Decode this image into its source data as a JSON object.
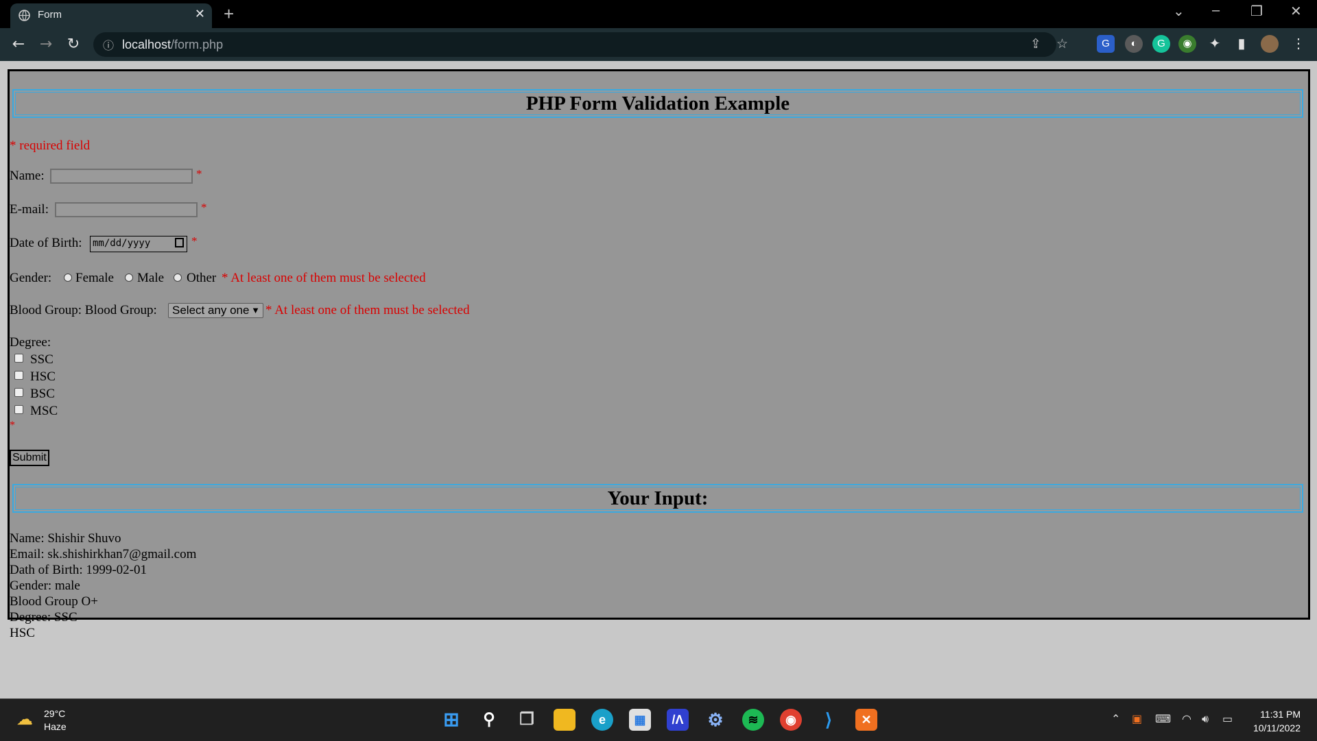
{
  "browser": {
    "tab_title": "Form",
    "tab_close": "✕",
    "new_tab": "+",
    "url_host": "localhost",
    "url_path": "/form.php",
    "controls": {
      "dropdown": "⌄",
      "minimize": "–",
      "restore": "❐",
      "close": "✕"
    }
  },
  "form": {
    "heading": "PHP Form Validation Example",
    "required_note": "* required field",
    "name_label": "Name:",
    "email_label": "E-mail:",
    "dob_label": "Date of Birth:",
    "dob_placeholder": "mm/dd/yyyy",
    "star": "*",
    "gender_label": "Gender:",
    "gender_options": [
      "Female",
      "Male",
      "Other"
    ],
    "gender_error": "* At least one of them must be selected",
    "blood_label": "Blood Group: Blood Group:",
    "blood_select_value": "Select any one",
    "blood_error": "* At least one of them must be selected",
    "degree_label": "Degree:",
    "degree_options": [
      "SSC",
      "HSC",
      "BSC",
      "MSC"
    ],
    "submit_label": "Submit"
  },
  "output": {
    "heading": "Your Input:",
    "lines": [
      "Name: Shishir Shuvo",
      "Email: sk.shishirkhan7@gmail.com",
      "Dath of Birth: 1999-02-01",
      "Gender: male",
      "Blood Group O+",
      "Degree: SSC",
      "HSC"
    ]
  },
  "taskbar": {
    "weather_temp": "29°C",
    "weather_desc": "Haze",
    "time": "11:31 PM",
    "date": "10/11/2022"
  },
  "colors": {
    "error": "#d90000",
    "heading_border": "#3aa9e0",
    "page_bg": "#969696"
  }
}
